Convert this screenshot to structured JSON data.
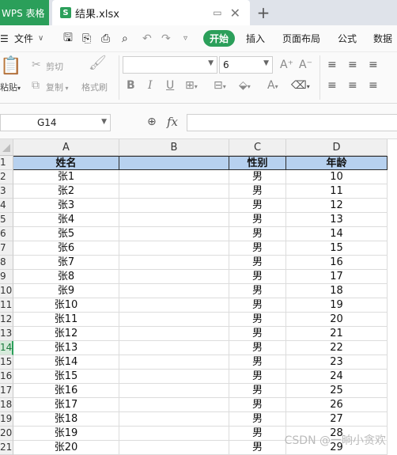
{
  "titlebar": {
    "app_tab_label": "WPS 表格",
    "file_badge": "S",
    "file_name": "结果.xlsx",
    "new_tab_glyph": "+"
  },
  "menubar": {
    "file_label": "文件",
    "items": [
      "开始",
      "插入",
      "页面布局",
      "公式",
      "数据"
    ]
  },
  "ribbon": {
    "paste_label": "粘贴",
    "cut_label": "剪切",
    "copy_label": "复制",
    "format_painter_label": "格式刷",
    "font_name": "",
    "font_size": "6",
    "bold_glyph": "B",
    "italic_glyph": "I",
    "underline_glyph": "U",
    "font_grow_glyph": "A⁺",
    "font_shrink_glyph": "A⁻",
    "font_color_glyph": "A"
  },
  "formula_bar": {
    "cell_ref": "G14",
    "fx_label": "fx",
    "formula_value": ""
  },
  "grid": {
    "columns": [
      "A",
      "B",
      "C",
      "D"
    ],
    "row_numbers": [
      "1",
      "2",
      "3",
      "4",
      "5",
      "6",
      "7",
      "8",
      "9",
      "10",
      "11",
      "12",
      "13",
      "14",
      "15",
      "16",
      "17",
      "18",
      "19",
      "20",
      "21"
    ],
    "active_row_index": 13,
    "header_row": [
      "姓名",
      "",
      "性别",
      "年龄"
    ],
    "rows": [
      [
        "张1",
        "",
        "男",
        "10"
      ],
      [
        "张2",
        "",
        "男",
        "11"
      ],
      [
        "张3",
        "",
        "男",
        "12"
      ],
      [
        "张4",
        "",
        "男",
        "13"
      ],
      [
        "张5",
        "",
        "男",
        "14"
      ],
      [
        "张6",
        "",
        "男",
        "15"
      ],
      [
        "张7",
        "",
        "男",
        "16"
      ],
      [
        "张8",
        "",
        "男",
        "17"
      ],
      [
        "张9",
        "",
        "男",
        "18"
      ],
      [
        "张10",
        "",
        "男",
        "19"
      ],
      [
        "张11",
        "",
        "男",
        "20"
      ],
      [
        "张12",
        "",
        "男",
        "21"
      ],
      [
        "张13",
        "",
        "男",
        "22"
      ],
      [
        "张14",
        "",
        "男",
        "23"
      ],
      [
        "张15",
        "",
        "男",
        "24"
      ],
      [
        "张16",
        "",
        "男",
        "25"
      ],
      [
        "张17",
        "",
        "男",
        "26"
      ],
      [
        "张18",
        "",
        "男",
        "27"
      ],
      [
        "张19",
        "",
        "男",
        "28"
      ],
      [
        "张20",
        "",
        "男",
        "29"
      ]
    ]
  },
  "watermark": "CSDN @一晌小贪欢",
  "colors": {
    "accent_green": "#2b9f5a",
    "header_fill": "#b7d1ef"
  }
}
